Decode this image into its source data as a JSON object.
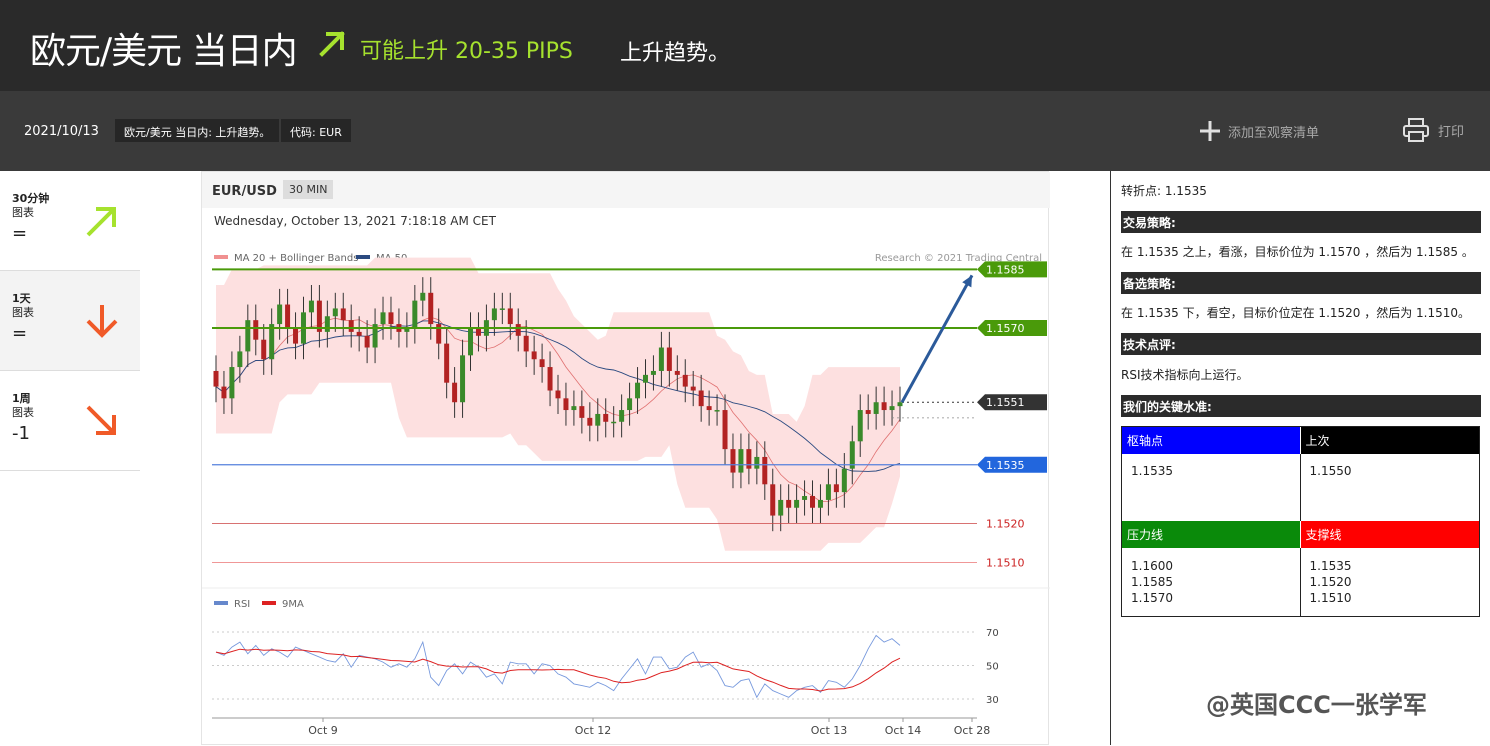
{
  "header": {
    "title": "欧元/美元 当日内",
    "trend_label": "可能上升 20-35 PIPS",
    "trend_sub": "上升趋势。",
    "accent": "#a6e22e"
  },
  "subbar": {
    "date": "2021/10/13",
    "tag1": "欧元/美元 当日内: 上升趋势。",
    "tag2": "代码: EUR",
    "watch_label": "添加至观察清单",
    "print_label": "打印"
  },
  "timeframes": [
    {
      "label": "30分钟",
      "sub": "图表",
      "value": "=",
      "direction": "up-right",
      "color": "#a6e22e"
    },
    {
      "label": "1天",
      "sub": "图表",
      "value": "=",
      "direction": "down",
      "color": "#f05a28"
    },
    {
      "label": "1周",
      "sub": "图表",
      "value": "-1",
      "direction": "down-right",
      "color": "#f05a28"
    }
  ],
  "chart": {
    "symbol": "EUR/USD",
    "period": "30 MIN",
    "timestamp": "Wednesday, October 13, 2021 7:18:18 AM CET",
    "legend_bb": "MA 20 + Bollinger Bands",
    "legend_ma50": "MA 50",
    "credit": "Research © 2021 Trading Central",
    "rsi_legend": "RSI",
    "rsi_ma_legend": "9MA",
    "x_labels": [
      "Oct 9",
      "Oct 12",
      "Oct 13",
      "Oct 14",
      "Oct 28"
    ],
    "rsi_levels": [
      "70",
      "50",
      "30"
    ],
    "levels": [
      {
        "value": "1.1585",
        "color": "#4a9a0a"
      },
      {
        "value": "1.1570",
        "color": "#4a9a0a"
      },
      {
        "value": "1.1551",
        "color": "#333333"
      },
      {
        "value": "1.1535",
        "color": "#2266dd"
      },
      {
        "value": "1.1520",
        "color": "#cc2222"
      },
      {
        "value": "1.1510",
        "color": "#cc2222"
      }
    ]
  },
  "chart_data": {
    "type": "candlestick",
    "title": "EUR/USD 30 MIN",
    "y_range": [
      1.1505,
      1.1592
    ],
    "x_labels": [
      "Oct 9",
      "Oct 12",
      "Oct 13",
      "Oct 14",
      "Oct 28"
    ],
    "close_series": [
      1.1555,
      1.1552,
      1.156,
      1.1564,
      1.1572,
      1.1567,
      1.1562,
      1.1571,
      1.1576,
      1.157,
      1.1566,
      1.1574,
      1.1577,
      1.1569,
      1.1573,
      1.1575,
      1.1572,
      1.1569,
      1.1568,
      1.1565,
      1.1571,
      1.1574,
      1.1571,
      1.1569,
      1.157,
      1.1577,
      1.1579,
      1.1571,
      1.1566,
      1.1556,
      1.1551,
      1.1563,
      1.157,
      1.1568,
      1.1572,
      1.1575,
      1.1575,
      1.1571,
      1.1568,
      1.1564,
      1.1562,
      1.156,
      1.1554,
      1.1552,
      1.1549,
      1.155,
      1.1547,
      1.1545,
      1.1548,
      1.1546,
      1.1546,
      1.1549,
      1.1552,
      1.1556,
      1.1558,
      1.1559,
      1.1565,
      1.1559,
      1.1558,
      1.1555,
      1.1554,
      1.155,
      1.1549,
      1.1549,
      1.1539,
      1.1533,
      1.1539,
      1.1534,
      1.1537,
      1.153,
      1.1522,
      1.1526,
      1.1524,
      1.1526,
      1.1527,
      1.1524,
      1.1526,
      1.153,
      1.1528,
      1.1534,
      1.1541,
      1.1549,
      1.1548,
      1.1551,
      1.1549,
      1.155,
      1.1551
    ],
    "rsi_series": [
      58,
      56,
      61,
      64,
      57,
      62,
      56,
      60,
      58,
      55,
      61,
      59,
      57,
      55,
      53,
      52,
      57,
      49,
      56,
      55,
      54,
      52,
      49,
      51,
      49,
      54,
      64,
      43,
      38,
      47,
      51,
      45,
      52,
      49,
      43,
      45,
      39,
      52,
      51,
      51,
      45,
      51,
      50,
      45,
      43,
      39,
      38,
      37,
      40,
      38,
      35,
      42,
      48,
      54,
      45,
      55,
      55,
      48,
      49,
      55,
      58,
      49,
      51,
      47,
      38,
      37,
      41,
      42,
      31,
      39,
      35,
      33,
      31,
      35,
      37,
      38,
      34,
      41,
      40,
      37,
      42,
      50,
      60,
      68,
      64,
      66,
      62
    ],
    "levels": [
      1.1585,
      1.157,
      1.1551,
      1.1535,
      1.152,
      1.151
    ]
  },
  "analysis": {
    "pivot_line": "转折点: 1.1535",
    "strategy_title": "交易策略:",
    "strategy_text": "在 1.1535 之上，看涨，目标价位为 1.1570 ，然后为 1.1585 。",
    "alt_title": "备选策略:",
    "alt_text": "在 1.1535 下，看空，目标价位定在 1.1520 ，然后为 1.1510。",
    "tech_title": "技术点评:",
    "tech_text": "RSI技术指标向上运行。",
    "key_title": "我们的关键水准:",
    "pivot_hdr": "枢轴点",
    "last_hdr": "上次",
    "pivot_val": "1.1535",
    "last_val": "1.1550",
    "res_hdr": "压力线",
    "sup_hdr": "支撑线",
    "res_vals": [
      "1.1600",
      "1.1585",
      "1.1570"
    ],
    "sup_vals": [
      "1.1535",
      "1.1520",
      "1.1510"
    ],
    "colors": {
      "pivot": "#0000ff",
      "last": "#000000",
      "res": "#0a8a0a",
      "sup": "#ff0000"
    }
  },
  "watermark": "@英国CCC一张学军"
}
